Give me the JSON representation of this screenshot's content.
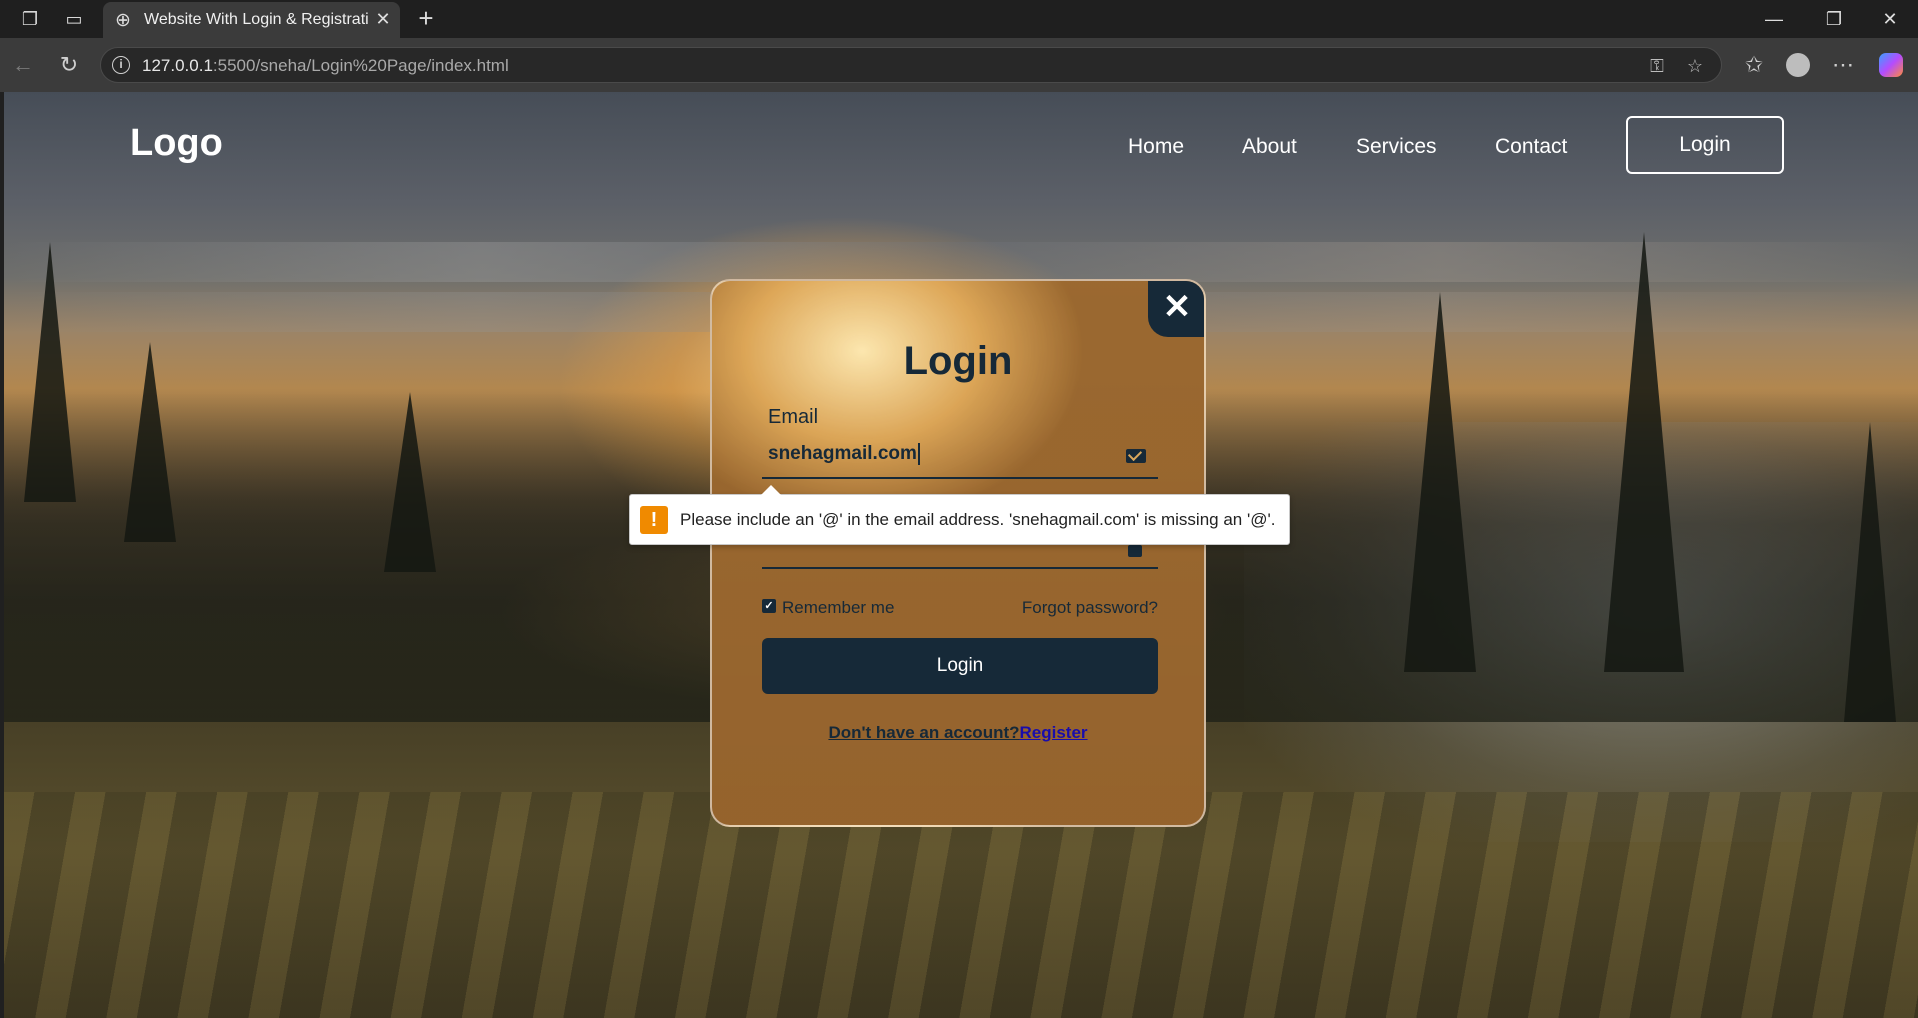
{
  "browser": {
    "tab_title": "Website With Login & Registration",
    "url_host": "127.0.0.1",
    "url_rest": ":5500/sneha/Login%20Page/index.html"
  },
  "site": {
    "logo": "Logo",
    "nav": [
      "Home",
      "About",
      "Services",
      "Contact"
    ],
    "nav_login": "Login"
  },
  "modal": {
    "title": "Login",
    "email_label": "Email",
    "email_value": "snehagmail.com",
    "password_dots": "••••••••",
    "remember_label": "Remember me",
    "remember_checked": true,
    "forgot": "Forgot password?",
    "login_button": "Login",
    "no_account": "Don't have an account?",
    "register": "Register"
  },
  "validation": {
    "message": "Please include an '@' in the email address. 'snehagmail.com' is missing an '@'."
  },
  "colors": {
    "primary": "#162938",
    "warning": "#f08a00",
    "link": "#1a0dab"
  }
}
